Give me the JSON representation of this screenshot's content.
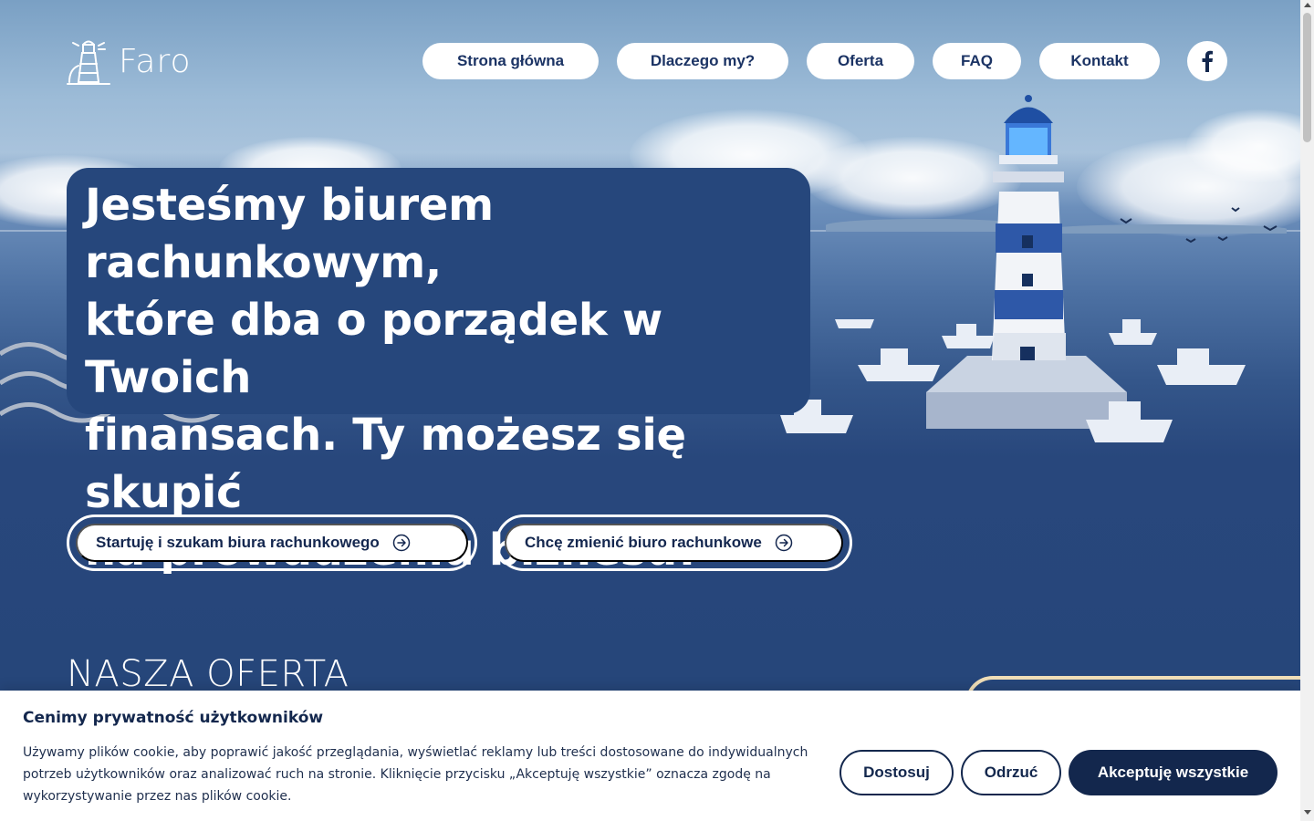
{
  "brand": {
    "name": "Faro",
    "logo_icon": "lighthouse-icon"
  },
  "nav": {
    "items": [
      {
        "label": "Strona główna"
      },
      {
        "label": "Dlaczego my?"
      },
      {
        "label": "Oferta"
      },
      {
        "label": "FAQ"
      },
      {
        "label": "Kontakt"
      }
    ],
    "social_icon": "facebook-icon"
  },
  "hero": {
    "headline_lines": [
      "Jesteśmy biurem rachunkowym,",
      "które dba o porządek w Twoich",
      "finansach. Ty możesz się skupić",
      "na prowadzeniu biznesu!"
    ],
    "cta": [
      {
        "label": "Startuję i szukam biura rachunkowego",
        "icon": "arrow-right-circle-icon"
      },
      {
        "label": "Chcę zmienić biuro rachunkowe",
        "icon": "arrow-right-circle-icon"
      }
    ]
  },
  "offer": {
    "title": "NASZA OFERTA"
  },
  "cookie_banner": {
    "title": "Cenimy prywatność użytkowników",
    "text_lines": [
      "Używamy plików cookie, aby poprawić jakość przeglądania, wyświetlać reklamy lub treści dostosowane do indywidualnych",
      "potrzeb użytkowników oraz analizować ruch na stronie. Kliknięcie przycisku „Akceptuję wszystkie” oznacza zgodę na",
      "wykorzystywanie przez nas plików cookie."
    ],
    "buttons": {
      "customize": "Dostosuj",
      "reject": "Odrzuć",
      "accept": "Akceptuję wszystkie"
    }
  },
  "colors": {
    "navy": "#26467a",
    "dark_navy": "#13274d",
    "white": "#ffffff",
    "cream_accent": "#f1dfb8"
  }
}
